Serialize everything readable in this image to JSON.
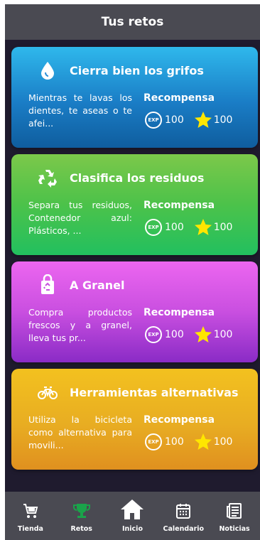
{
  "header": {
    "title": "Tus retos"
  },
  "challenges": [
    {
      "title": "Cierra bien los grifos",
      "description": "Mientras te lavas los dientes, te aseas o te afei...",
      "reward_label": "Recompensa",
      "exp_badge": "EXP",
      "exp": "100",
      "stars": "100",
      "icon": "water-drop-icon"
    },
    {
      "title": "Clasifica los residuos",
      "description": "Separa tus residuos, Contenedor azul: Plásticos, ...",
      "reward_label": "Recompensa",
      "exp_badge": "EXP",
      "exp": "100",
      "stars": "100",
      "icon": "recycle-icon"
    },
    {
      "title": "A Granel",
      "description": "Compra productos frescos y a granel, lleva tus pr...",
      "reward_label": "Recompensa",
      "exp_badge": "EXP",
      "exp": "100",
      "stars": "100",
      "icon": "recycle-bag-icon"
    },
    {
      "title": "Herramientas alternativas",
      "description": "Utiliza la bicicleta como alternativa para movili...",
      "reward_label": "Recompensa",
      "exp_badge": "EXP",
      "exp": "100",
      "stars": "100",
      "icon": "bicycle-icon"
    }
  ],
  "tabs": [
    {
      "label": "Tienda",
      "icon": "cart-icon",
      "active": false
    },
    {
      "label": "Retos",
      "icon": "trophy-icon",
      "active": true
    },
    {
      "label": "Inicio",
      "icon": "home-icon",
      "active": false
    },
    {
      "label": "Calendario",
      "icon": "calendar-icon",
      "active": false
    },
    {
      "label": "Noticias",
      "icon": "newspaper-icon",
      "active": false
    }
  ],
  "colors": {
    "header_bg": "#4a4a52",
    "screen_bg": "#1f1b2e",
    "active_tab": "#1aa34a",
    "star": "#ffe600"
  }
}
